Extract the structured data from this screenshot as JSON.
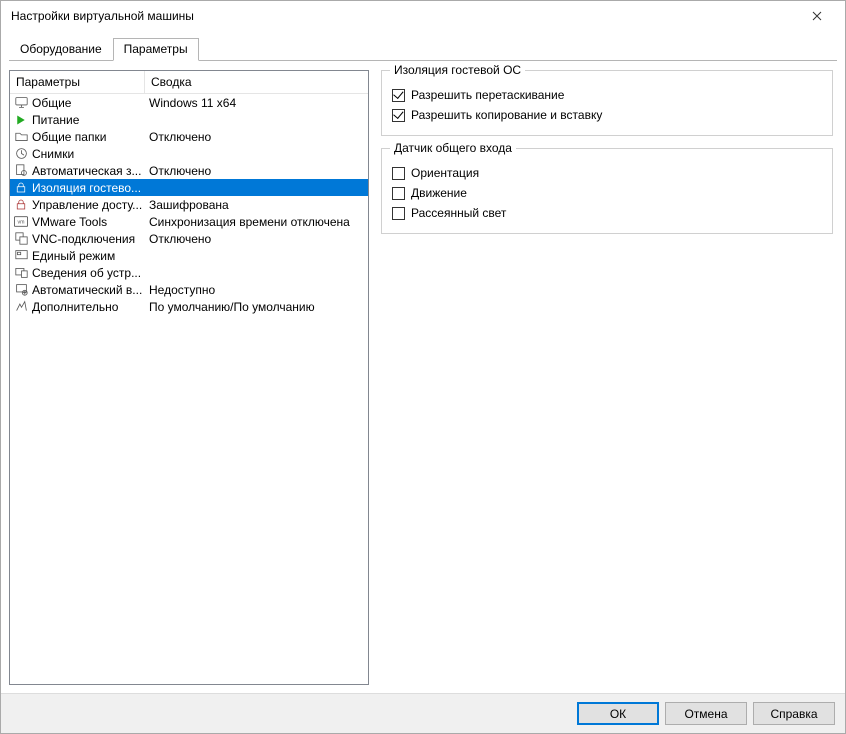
{
  "window": {
    "title": "Настройки виртуальной машины"
  },
  "tabs": {
    "hardware": "Оборудование",
    "options": "Параметры"
  },
  "columns": {
    "name": "Параметры",
    "summary": "Сводка"
  },
  "rows": [
    {
      "icon": "monitor",
      "name": "Общие",
      "summary": "Windows 11 x64"
    },
    {
      "icon": "play",
      "name": "Питание",
      "summary": ""
    },
    {
      "icon": "folder",
      "name": "Общие папки",
      "summary": "Отключено"
    },
    {
      "icon": "clock",
      "name": "Снимки",
      "summary": ""
    },
    {
      "icon": "doc-gear",
      "name": "Автоматическая з...",
      "summary": "Отключено"
    },
    {
      "icon": "lock",
      "name": "Изоляция гостево...",
      "summary": "",
      "selected": true
    },
    {
      "icon": "lock-red",
      "name": "Управление досту...",
      "summary": "Зашифрована"
    },
    {
      "icon": "vmw",
      "name": "VMware Tools",
      "summary": "Синхронизация времени отключена"
    },
    {
      "icon": "vnc",
      "name": "VNC-подключения",
      "summary": "Отключено"
    },
    {
      "icon": "unity",
      "name": "Единый режим",
      "summary": ""
    },
    {
      "icon": "device",
      "name": "Сведения об устр...",
      "summary": ""
    },
    {
      "icon": "auto",
      "name": "Автоматический в...",
      "summary": "Недоступно"
    },
    {
      "icon": "adv",
      "name": "Дополнительно",
      "summary": "По умолчанию/По умолчанию"
    }
  ],
  "isolation": {
    "legend": "Изоляция гостевой ОС",
    "drag": {
      "label": "Разрешить перетаскивание",
      "checked": true
    },
    "copy": {
      "label": "Разрешить копирование и вставку",
      "checked": true
    }
  },
  "sensor": {
    "legend": "Датчик общего входа",
    "orientation": {
      "label": "Ориентация",
      "checked": false
    },
    "motion": {
      "label": "Движение",
      "checked": false
    },
    "ambient": {
      "label": "Рассеянный свет",
      "checked": false
    }
  },
  "buttons": {
    "ok": "ОК",
    "cancel": "Отмена",
    "help": "Справка"
  }
}
